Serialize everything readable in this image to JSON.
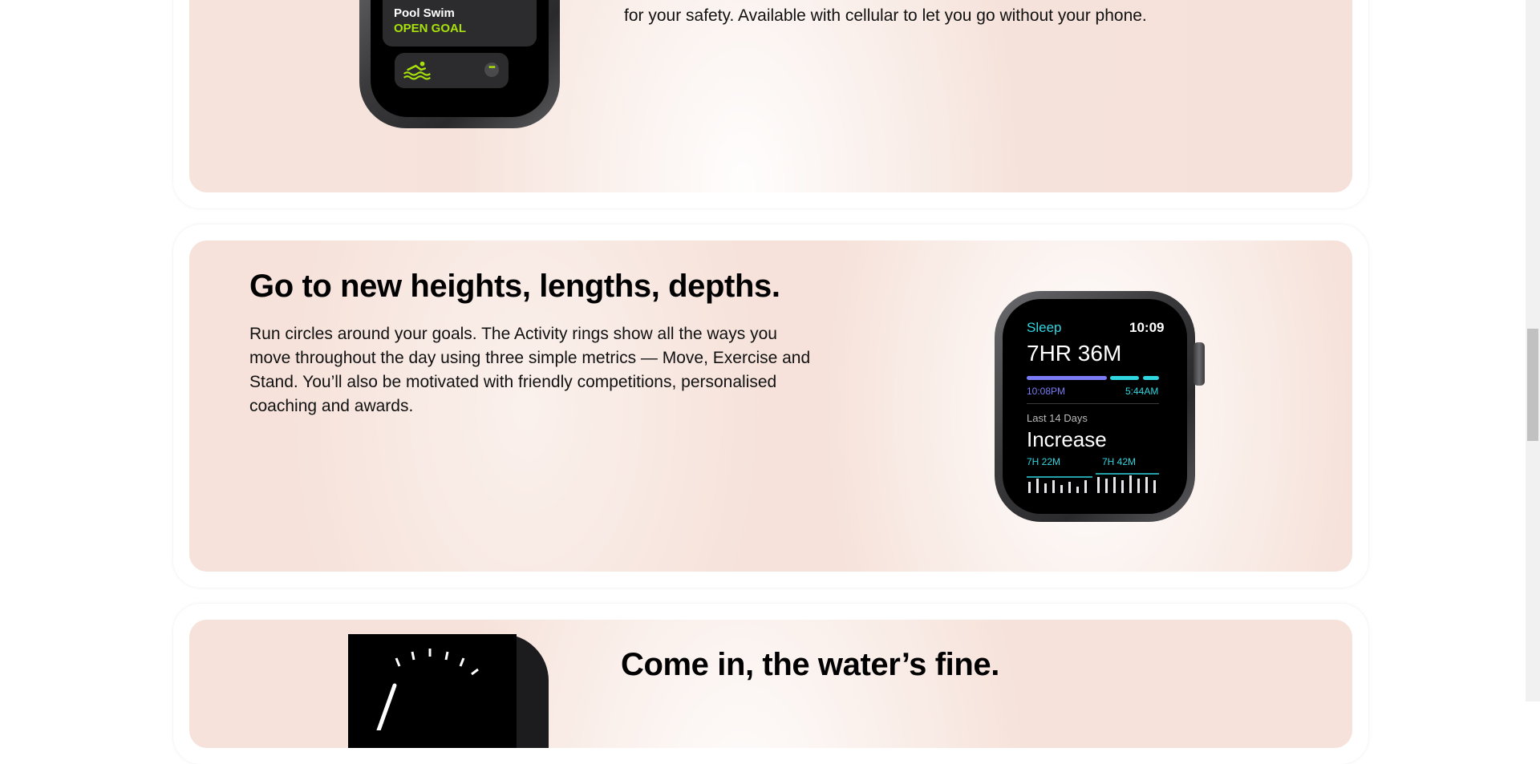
{
  "section_top": {
    "body_line": "for your safety. Available with cellular to let you go without your phone.",
    "watch": {
      "workout_label": "Pool Swim",
      "goal_label": "OPEN GOAL",
      "more_glyph": "•••",
      "icon": "swimmer-icon"
    }
  },
  "section_middle": {
    "heading": "Go to new heights, lengths, depths.",
    "body_lines": [
      "Run circles around your goals. The Activity rings show all the ways you",
      "move throughout the day using three simple metrics — Move, Exercise and",
      "Stand. You’ll also be motivated with friendly competitions, personalised",
      "coaching and awards."
    ],
    "watch": {
      "app_label": "Sleep",
      "time": "10:09",
      "duration": "7HR 36M",
      "start_time": "10:08PM",
      "end_time": "5:44AM",
      "period_label": "Last 14 Days",
      "trend": "Increase",
      "avg_before": "7H 22M",
      "avg_after": "7H 42M",
      "accent_color": "#2fd6e0",
      "bar_color": "#7b7bf5"
    }
  },
  "section_bottom": {
    "heading": "Come in, the water’s fine."
  },
  "colors": {
    "panel_bg": "#f6e2da",
    "swim_accent": "#a8e10c"
  }
}
